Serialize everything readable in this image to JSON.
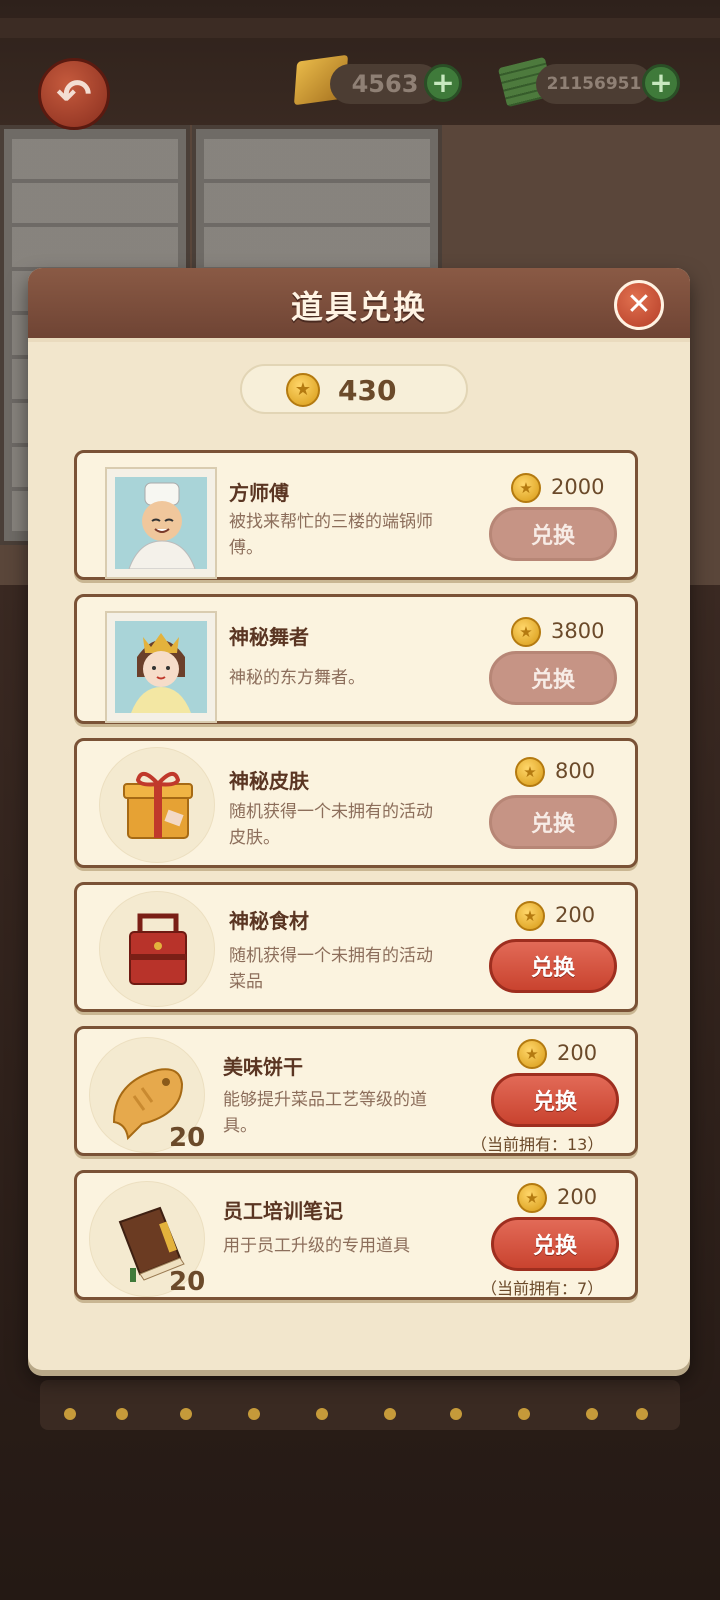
{
  "hud": {
    "gold_amount": "4563",
    "cash_amount": "21156951"
  },
  "dialog": {
    "title": "道具兑换",
    "balance": "430"
  },
  "items": [
    {
      "name": "方师傅",
      "desc": "被找来帮忙的三楼的端锅师傅。",
      "price": "2000",
      "button": "兑换",
      "state": "disabled"
    },
    {
      "name": "神秘舞者",
      "desc": "神秘的东方舞者。",
      "price": "3800",
      "button": "兑换",
      "state": "disabled"
    },
    {
      "name": "神秘皮肤",
      "desc": "随机获得一个未拥有的活动皮肤。",
      "price": "800",
      "button": "兑换",
      "state": "disabled"
    },
    {
      "name": "神秘食材",
      "desc": "随机获得一个未拥有的活动菜品",
      "price": "200",
      "button": "兑换",
      "state": "active"
    },
    {
      "name": "美味饼干",
      "desc": "能够提升菜品工艺等级的道具。",
      "price": "200",
      "button": "兑换",
      "state": "active",
      "count": "20",
      "owned": "（当前拥有：13）"
    },
    {
      "name": "员工培训笔记",
      "desc": "用于员工升级的专用道具",
      "price": "200",
      "button": "兑换",
      "state": "active",
      "count": "20",
      "owned": "（当前拥有：7）"
    }
  ],
  "colors": {
    "accent_red": "#c9432f",
    "disabled_button": "#c69485",
    "header_brown": "#6f4434",
    "paper": "#f2e6cc"
  }
}
